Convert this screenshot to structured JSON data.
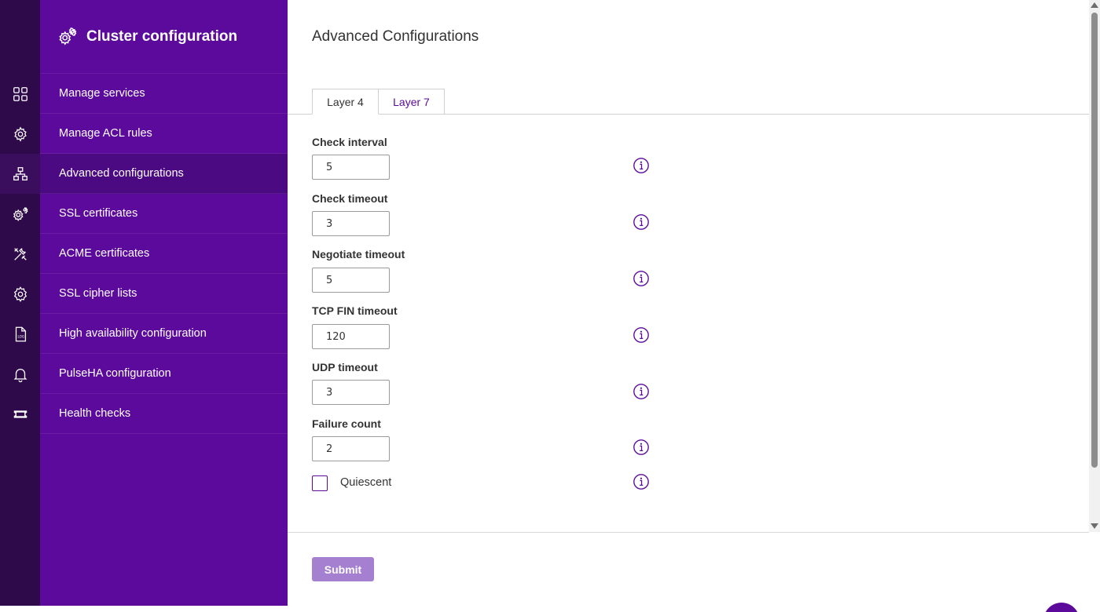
{
  "sidebar": {
    "title": "Cluster configuration",
    "header_icon": "gears-icon",
    "items": [
      {
        "label": "Manage services",
        "icon": "grid-icon"
      },
      {
        "label": "Manage ACL rules",
        "icon": "gear-outline-icon"
      },
      {
        "label": "Advanced configurations",
        "icon": "network-icon",
        "active": true
      },
      {
        "label": "SSL certificates",
        "icon": "gears-icon"
      },
      {
        "label": "ACME certificates",
        "icon": "tools-icon"
      },
      {
        "label": "SSL cipher lists",
        "icon": "gear-icon"
      },
      {
        "label": "High availability configuration",
        "icon": "log-file-icon"
      },
      {
        "label": "PulseHA configuration",
        "icon": "bell-icon"
      },
      {
        "label": "Health checks",
        "icon": "ticket-icon"
      }
    ]
  },
  "main": {
    "title": "Advanced Configurations",
    "tabs": [
      {
        "label": "Layer 4",
        "active": true
      },
      {
        "label": "Layer 7",
        "active": false
      }
    ],
    "fields": [
      {
        "label": "Check interval",
        "value": "5"
      },
      {
        "label": "Check timeout",
        "value": "3"
      },
      {
        "label": "Negotiate timeout",
        "value": "5"
      },
      {
        "label": "TCP FIN timeout",
        "value": "120"
      },
      {
        "label": "UDP timeout",
        "value": "3"
      },
      {
        "label": "Failure count",
        "value": "2"
      }
    ],
    "checkbox": {
      "label": "Quiescent",
      "checked": false
    },
    "submit_label": "Submit"
  },
  "colors": {
    "rail": "#2e0a4a",
    "sidebar": "#5c0a9c",
    "sidebar_active": "#4b0a82",
    "accent": "#5c0a9c",
    "submit": "#a57fd0"
  }
}
